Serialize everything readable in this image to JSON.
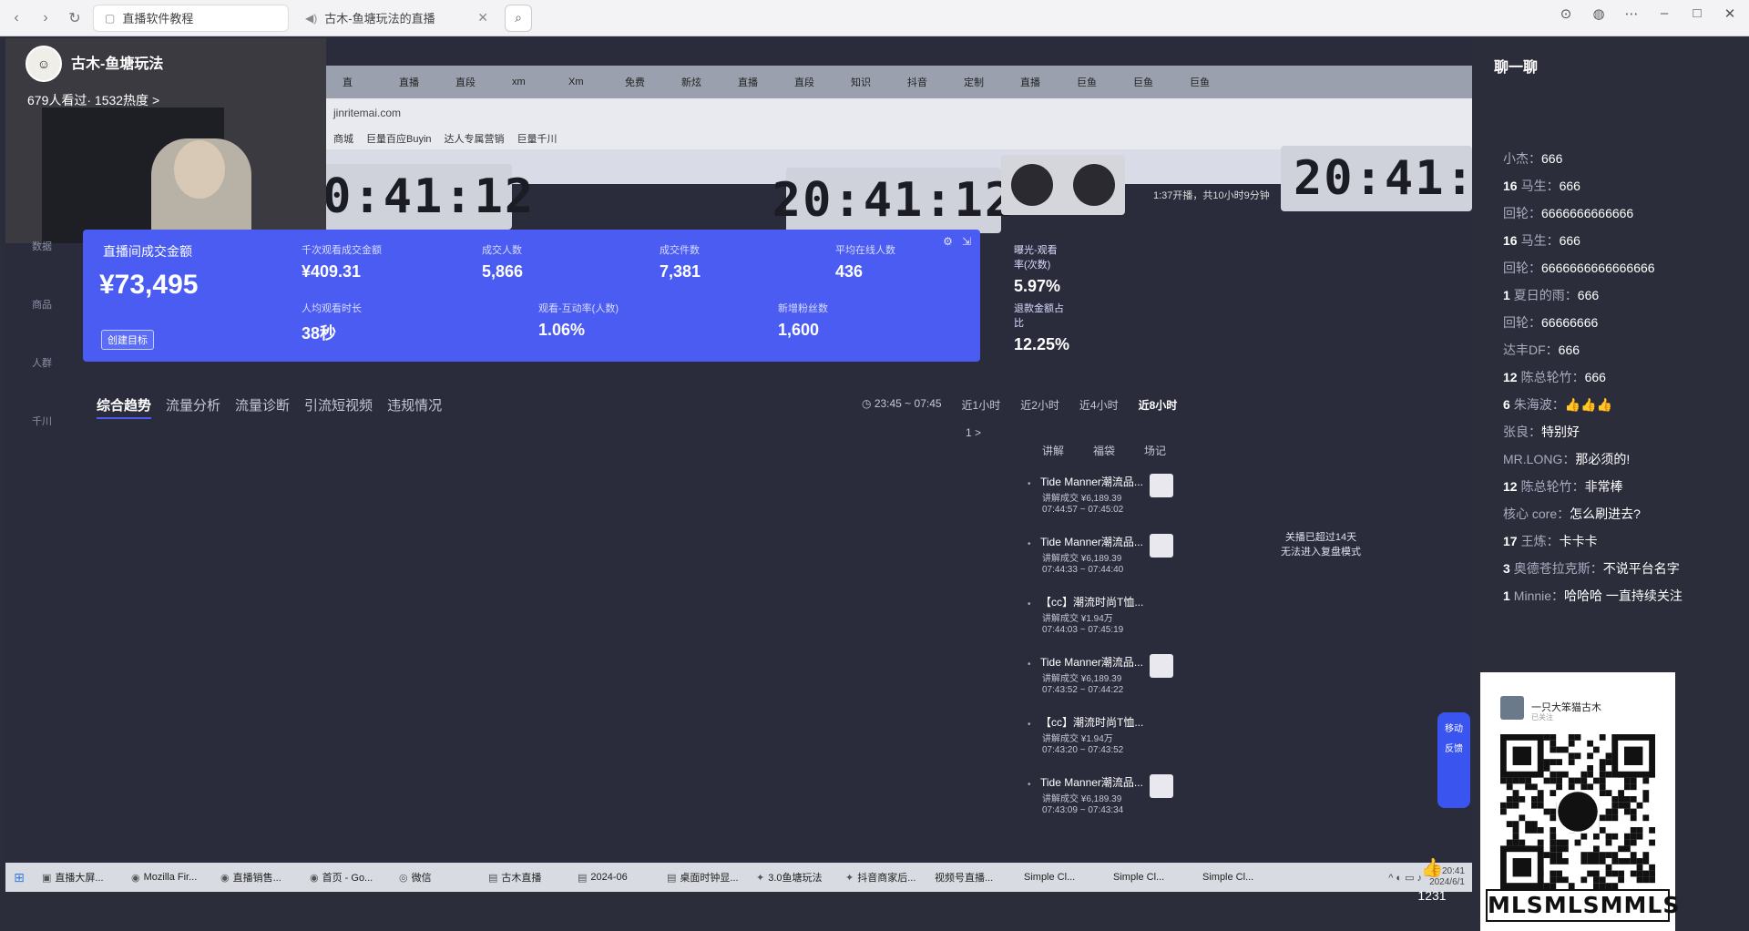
{
  "browser": {
    "tabs": [
      {
        "label": "直播软件教程",
        "active": true
      },
      {
        "label": "古木-鱼塘玩法的直播",
        "active": false
      }
    ]
  },
  "host": {
    "name": "古木-鱼塘玩法",
    "viewers": "679人看过· 1532热度 >"
  },
  "inner_browser": {
    "tabs": [
      "直",
      "直播",
      "直段",
      "xm",
      "Xm",
      "免费",
      "新炫",
      "直播",
      "直段",
      "知识",
      "抖音",
      "定制",
      "直播",
      "巨鱼",
      "巨鱼",
      "巨鱼"
    ],
    "url": "jinritemai.com",
    "bookmarks": [
      "商城",
      "巨量百应Buyin",
      "达人专属营销",
      "巨量千川"
    ]
  },
  "clocks": {
    "time": "20:41:12",
    "start_info": "1:37开播，共10小时9分钟"
  },
  "left_rail": [
    "数据",
    "商品",
    "人群",
    "千川"
  ],
  "stats": {
    "title": "直播间成交金额",
    "total": "¥73,495",
    "target_btn": "创建目标",
    "metrics": [
      {
        "label": "千次观看成交金额",
        "value": "¥409.31"
      },
      {
        "label": "成交人数",
        "value": "5,866"
      },
      {
        "label": "成交件数",
        "value": "7,381"
      },
      {
        "label": "平均在线人数",
        "value": "436"
      },
      {
        "label": "曝光-观看率(次数)",
        "value": "5.97%"
      },
      {
        "label": "人均观看时长",
        "value": "38秒"
      },
      {
        "label": "观看-互动率(人数)",
        "value": "1.06%"
      },
      {
        "label": "新增粉丝数",
        "value": "1,600"
      },
      {
        "label": "退款金额占比",
        "value": "12.25%"
      }
    ]
  },
  "subtabs": [
    "综合趋势",
    "流量分析",
    "流量诊断",
    "引流短视频",
    "违规情况"
  ],
  "time_range": "23:45 ~ 07:45",
  "time_filters": [
    "近1小时",
    "近2小时",
    "近4小时",
    "近8小时"
  ],
  "pager": "1 >",
  "list_heads": [
    "讲解",
    "福袋",
    "场记"
  ],
  "clips": [
    {
      "name": "Tide Manner潮流品...",
      "deal": "讲解成交 ¥6,189.39",
      "time": "07:44:57 ~ 07:45:02"
    },
    {
      "name": "Tide Manner潮流品...",
      "deal": "讲解成交 ¥6,189.39",
      "time": "07:44:33 ~ 07:44:40"
    },
    {
      "name": "【cc】潮流时尚T恤...",
      "deal": "讲解成交 ¥1.94万",
      "time": "07:44:03 ~ 07:45:19"
    },
    {
      "name": "Tide Manner潮流品...",
      "deal": "讲解成交 ¥6,189.39",
      "time": "07:43:52 ~ 07:44:22"
    },
    {
      "name": "【cc】潮流时尚T恤...",
      "deal": "讲解成交 ¥1.94万",
      "time": "07:43:20 ~ 07:43:52"
    },
    {
      "name": "Tide Manner潮流品...",
      "deal": "讲解成交 ¥6,189.39",
      "time": "07:43:09 ~ 07:43:34"
    }
  ],
  "review_note": [
    "关播已超过14天",
    "无法进入复盘模式"
  ],
  "side_widget": [
    "移动",
    "反馈"
  ],
  "taskbar": {
    "items": [
      "直播大屏...",
      "Mozilla Fir...",
      "直播销售...",
      "首页 - Go...",
      "微信",
      "古木直播",
      "2024-06",
      "桌面时钟显...",
      "3.0鱼塘玩法",
      "抖音商家后...",
      "视频号直播...",
      "Simple Cl...",
      "Simple Cl...",
      "Simple Cl..."
    ],
    "clock_time": "20:41",
    "clock_date": "2024/6/1"
  },
  "likes": "1231",
  "chat": {
    "title": "聊一聊",
    "messages": [
      {
        "badge": "",
        "user": "小杰：",
        "msg": "666"
      },
      {
        "badge": "16",
        "user": "马生：",
        "msg": "666"
      },
      {
        "badge": "",
        "user": "回轮：",
        "msg": "6666666666666"
      },
      {
        "badge": "16",
        "user": "马生：",
        "msg": "666"
      },
      {
        "badge": "",
        "user": "回轮：",
        "msg": "6666666666666666"
      },
      {
        "badge": "1",
        "user": "夏日的雨：",
        "msg": "666"
      },
      {
        "badge": "",
        "user": "回轮：",
        "msg": "66666666"
      },
      {
        "badge": "",
        "user": "达丰DF：",
        "msg": "666"
      },
      {
        "badge": "12",
        "user": "陈总轮竹：",
        "msg": "666"
      },
      {
        "badge": "6",
        "user": "朱海波：",
        "msg": "👍👍👍"
      },
      {
        "badge": "",
        "user": "张良：",
        "msg": "特别好"
      },
      {
        "badge": "",
        "user": "MR.LONG：",
        "msg": "那必须的!"
      },
      {
        "badge": "12",
        "user": "陈总轮竹：",
        "msg": "非常棒"
      },
      {
        "badge": "",
        "user": "核心 core：",
        "msg": "怎么刷进去?"
      },
      {
        "badge": "17",
        "user": "王炼：",
        "msg": "卡卡卡"
      },
      {
        "badge": "3",
        "user": "奥德苍拉克斯：",
        "msg": "不说平台名字"
      },
      {
        "badge": "1",
        "user": "Minnie：",
        "msg": "哈哈哈 一直持续关注"
      }
    ]
  },
  "qr_card": {
    "owner": "一只大笨猫古木",
    "owner_sub": "已关注",
    "watermark": "MLSMLSMMLS"
  },
  "colors": {
    "stats_panel": "#4a5cf2",
    "background": "#2b2d3a"
  }
}
